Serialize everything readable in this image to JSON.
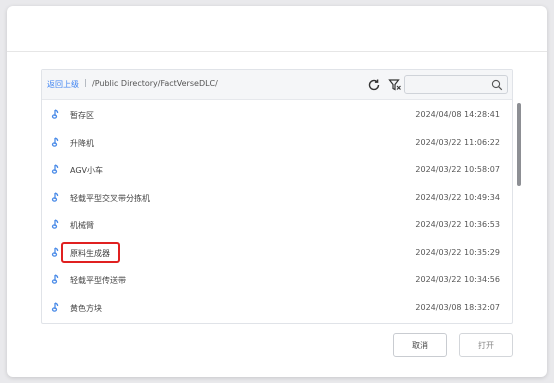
{
  "toolbar": {
    "back_label": "返回上级",
    "separator": "|",
    "path": "/Public Directory/FactVerseDLC/",
    "search_placeholder": "",
    "search_value": ""
  },
  "files": [
    {
      "name": "暂存区",
      "date": "2024/04/08 14:28:41",
      "icon": "file-icon"
    },
    {
      "name": "升降机",
      "date": "2024/03/22 11:06:22",
      "icon": "file-icon"
    },
    {
      "name": "AGV小车",
      "date": "2024/03/22 10:58:07",
      "icon": "file-icon"
    },
    {
      "name": "轻载平型交叉带分拣机",
      "date": "2024/03/22 10:49:34",
      "icon": "file-icon"
    },
    {
      "name": "机械臂",
      "date": "2024/03/22 10:36:53",
      "icon": "file-icon"
    },
    {
      "name": "原料生成器",
      "date": "2024/03/22 10:35:29",
      "icon": "file-icon",
      "selected": true
    },
    {
      "name": "轻载平型传送带",
      "date": "2024/03/22 10:34:56",
      "icon": "file-icon"
    },
    {
      "name": "黄色方块",
      "date": "2024/03/08 18:32:07",
      "icon": "file-icon"
    }
  ],
  "footer": {
    "cancel_label": "取消",
    "open_label": "打开"
  },
  "colors": {
    "link": "#3e83f2",
    "highlight": "#e02020",
    "icon": "#4a8be8"
  }
}
